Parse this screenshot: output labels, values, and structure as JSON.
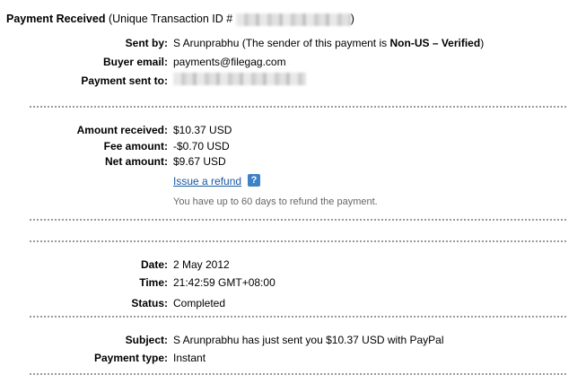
{
  "header": {
    "title_bold": "Payment Received",
    "title_rest": "(Unique Transaction ID #",
    "title_close": ")"
  },
  "sender": {
    "sent_by_label": "Sent by:",
    "sent_by_name": "S Arunprabhu",
    "sent_by_note_pre": "(The sender of this payment is",
    "sent_by_note_bold": "Non-US – Verified",
    "sent_by_note_post": ")",
    "buyer_email_label": "Buyer email:",
    "buyer_email": "payments@filegag.com",
    "payment_sent_to_label": "Payment sent to:"
  },
  "amounts": {
    "received_label": "Amount received:",
    "received": "$10.37 USD",
    "fee_label": "Fee amount:",
    "fee": "-$0.70 USD",
    "net_label": "Net amount:",
    "net": "$9.67 USD",
    "refund_link": "Issue a refund",
    "help_icon_text": "?",
    "refund_note": "You have up to 60 days to refund the payment."
  },
  "details": {
    "date_label": "Date:",
    "date": "2 May 2012",
    "time_label": "Time:",
    "time": "21:42:59 GMT+08:00",
    "status_label": "Status:",
    "status": "Completed"
  },
  "message": {
    "subject_label": "Subject:",
    "subject": "S Arunprabhu has just sent you $10.37 USD with PayPal",
    "payment_type_label": "Payment type:",
    "payment_type": "Instant"
  },
  "colors": {
    "link": "#1a57a3",
    "help_icon_bg": "#3e82c6",
    "separator": "#9a9a9a",
    "note_text": "#666666"
  }
}
